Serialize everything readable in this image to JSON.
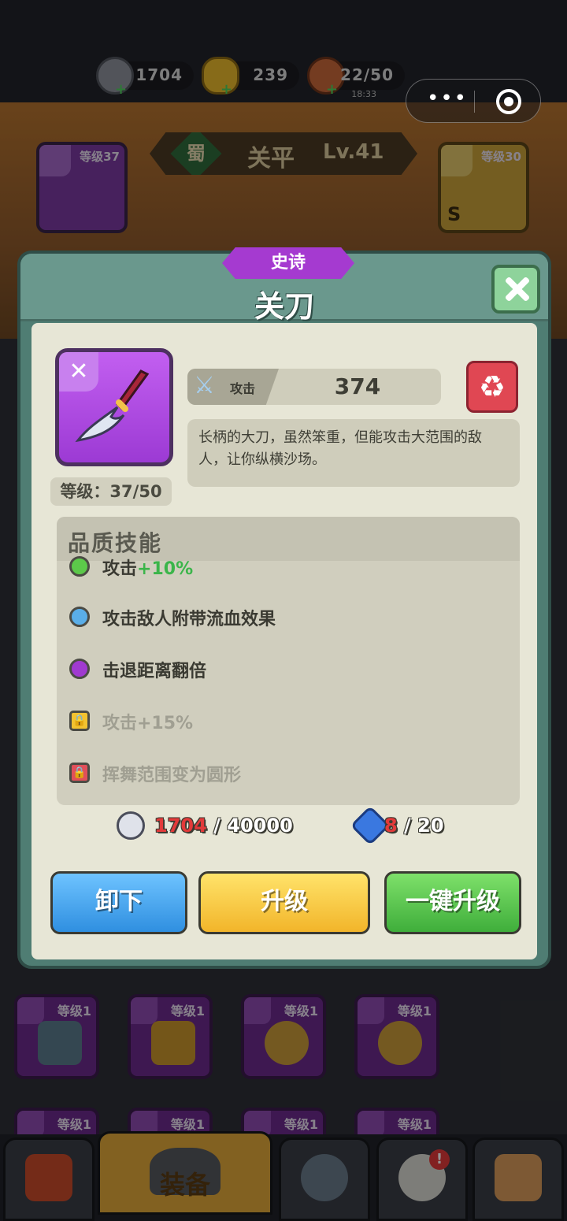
{
  "resources": [
    {
      "icon": "silver-coin-icon",
      "value": "1704"
    },
    {
      "icon": "gold-ingot-icon",
      "value": "239"
    },
    {
      "icon": "meat-leg-icon",
      "value": "22/50",
      "sub": "18:33"
    }
  ],
  "hero": {
    "faction": "蜀",
    "name": "关平",
    "level": "Lv.41"
  },
  "slots": {
    "left_level": "等级37",
    "right_level": "等级30",
    "right_grade": "S"
  },
  "modal": {
    "rarity": "史诗",
    "title": "关刀",
    "item_level": "等级：37/50",
    "attack_label": "攻击",
    "attack_value": "374",
    "description": "长柄的大刀，虽然笨重，但能攻击大范围的敌人，让你纵横沙场。",
    "skills_title": "品质技能",
    "skills": [
      {
        "prefix": "攻击",
        "highlight": "+10%",
        "color": "#5cc94a",
        "locked": false
      },
      {
        "text": "攻击敌人附带流血效果",
        "color": "#5aaee8",
        "locked": false
      },
      {
        "text": "击退距离翻倍",
        "color": "#a03ad0",
        "locked": false
      },
      {
        "text": "攻击+15%",
        "lock_color": "#f2c230",
        "locked": true
      },
      {
        "text": "挥舞范围变为圆形",
        "lock_color": "#e0505a",
        "locked": true
      }
    ],
    "cost_coins_have": "1704",
    "cost_coins_need": " / 40000",
    "cost_stone_have": "8",
    "cost_stone_need": " / 20",
    "btn_unequip": "卸下",
    "btn_upgrade": "升级",
    "btn_one_click": "一键升级"
  },
  "equipment_rows": [
    [
      "等级1",
      "等级1",
      "等级1",
      "等级1"
    ],
    [
      "等级1",
      "等级1",
      "等级1",
      "等级1"
    ]
  ],
  "nav": {
    "active_label": "装备",
    "badge": "!"
  }
}
